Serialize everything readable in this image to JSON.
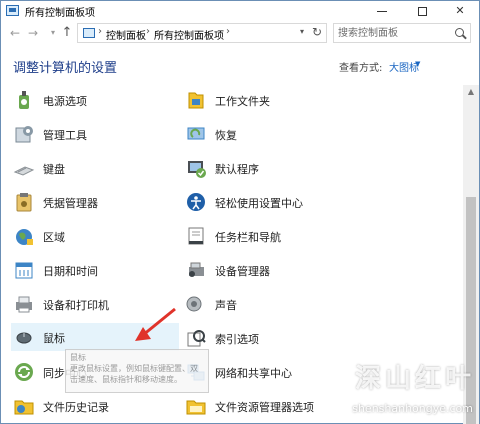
{
  "window": {
    "title": "所有控制面板项"
  },
  "navbar": {
    "breadcrumbs": [
      "控制面板",
      "所有控制面板项"
    ],
    "separator": "›",
    "search_placeholder": "搜索控制面板"
  },
  "content": {
    "heading": "调整计算机的设置",
    "view_by_label": "查看方式:",
    "view_by_value": "大图标"
  },
  "items_left": [
    {
      "label": "电源选项",
      "icon": "power-options-icon"
    },
    {
      "label": "管理工具",
      "icon": "admin-tools-icon"
    },
    {
      "label": "键盘",
      "icon": "keyboard-icon"
    },
    {
      "label": "凭据管理器",
      "icon": "credential-manager-icon"
    },
    {
      "label": "区域",
      "icon": "region-icon"
    },
    {
      "label": "日期和时间",
      "icon": "date-time-icon"
    },
    {
      "label": "设备和打印机",
      "icon": "devices-printers-icon"
    },
    {
      "label": "鼠标",
      "icon": "mouse-icon"
    },
    {
      "label": "同步中心",
      "icon": "sync-center-icon"
    },
    {
      "label": "文件历史记录",
      "icon": "file-history-icon"
    }
  ],
  "items_right": [
    {
      "label": "工作文件夹",
      "icon": "work-folders-icon"
    },
    {
      "label": "恢复",
      "icon": "recovery-icon"
    },
    {
      "label": "默认程序",
      "icon": "default-programs-icon"
    },
    {
      "label": "轻松使用设置中心",
      "icon": "ease-of-access-icon"
    },
    {
      "label": "任务栏和导航",
      "icon": "taskbar-icon"
    },
    {
      "label": "设备管理器",
      "icon": "device-manager-icon"
    },
    {
      "label": "声音",
      "icon": "sound-icon"
    },
    {
      "label": "索引选项",
      "icon": "indexing-options-icon"
    },
    {
      "label": "网络和共享中心",
      "icon": "network-sharing-icon"
    },
    {
      "label": "文件资源管理器选项",
      "icon": "file-explorer-options-icon"
    }
  ],
  "tooltip": {
    "title": "鼠标",
    "line1": "更改鼠标设置，例如鼠标键配置、双",
    "line2": "击速度、鼠标指针和移动速度。"
  },
  "watermark": {
    "text": "深山红叶",
    "url": "shenshanhongye.com"
  },
  "colors": {
    "accent": "#1a66c2",
    "heading": "#1e3e8a",
    "hover": "#e5f3fb",
    "arrow": "#e0332a"
  }
}
